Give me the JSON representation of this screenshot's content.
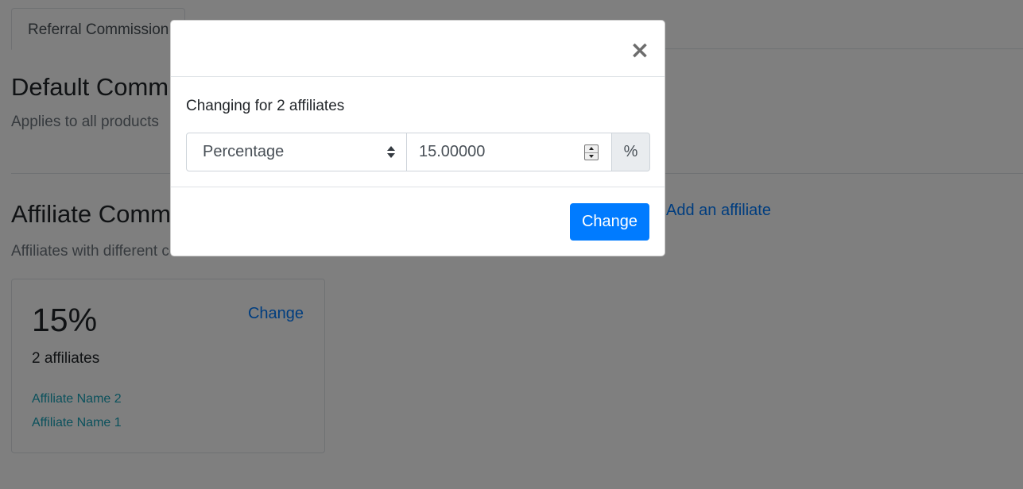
{
  "background": {
    "tab_label": "Referral Commission",
    "default_section": {
      "title": "Default Commission",
      "subtitle": "Applies to all products"
    },
    "affiliate_section": {
      "title": "Affiliate Commission",
      "subtitle": "Affiliates with different commission than default",
      "add_link": "Add an affiliate"
    },
    "card": {
      "rate": "15%",
      "change_link": "Change",
      "count": "2 affiliates",
      "affiliates": [
        "Affiliate Name 2",
        "Affiliate Name 1"
      ]
    }
  },
  "modal": {
    "close_symbol": "×",
    "lead": "Changing for 2 affiliates",
    "type_select": {
      "value": "Percentage"
    },
    "amount_input": {
      "value": "15.00000"
    },
    "unit_addon": "%",
    "submit_label": "Change"
  },
  "colors": {
    "primary": "#007bff",
    "affiliate_link": "#17a2b8",
    "backdrop": "rgba(0,0,0,0.5)"
  },
  "icons": {
    "close": "close-icon",
    "select_arrows": "select-arrows-icon",
    "spinner": "number-spinner-icon"
  }
}
